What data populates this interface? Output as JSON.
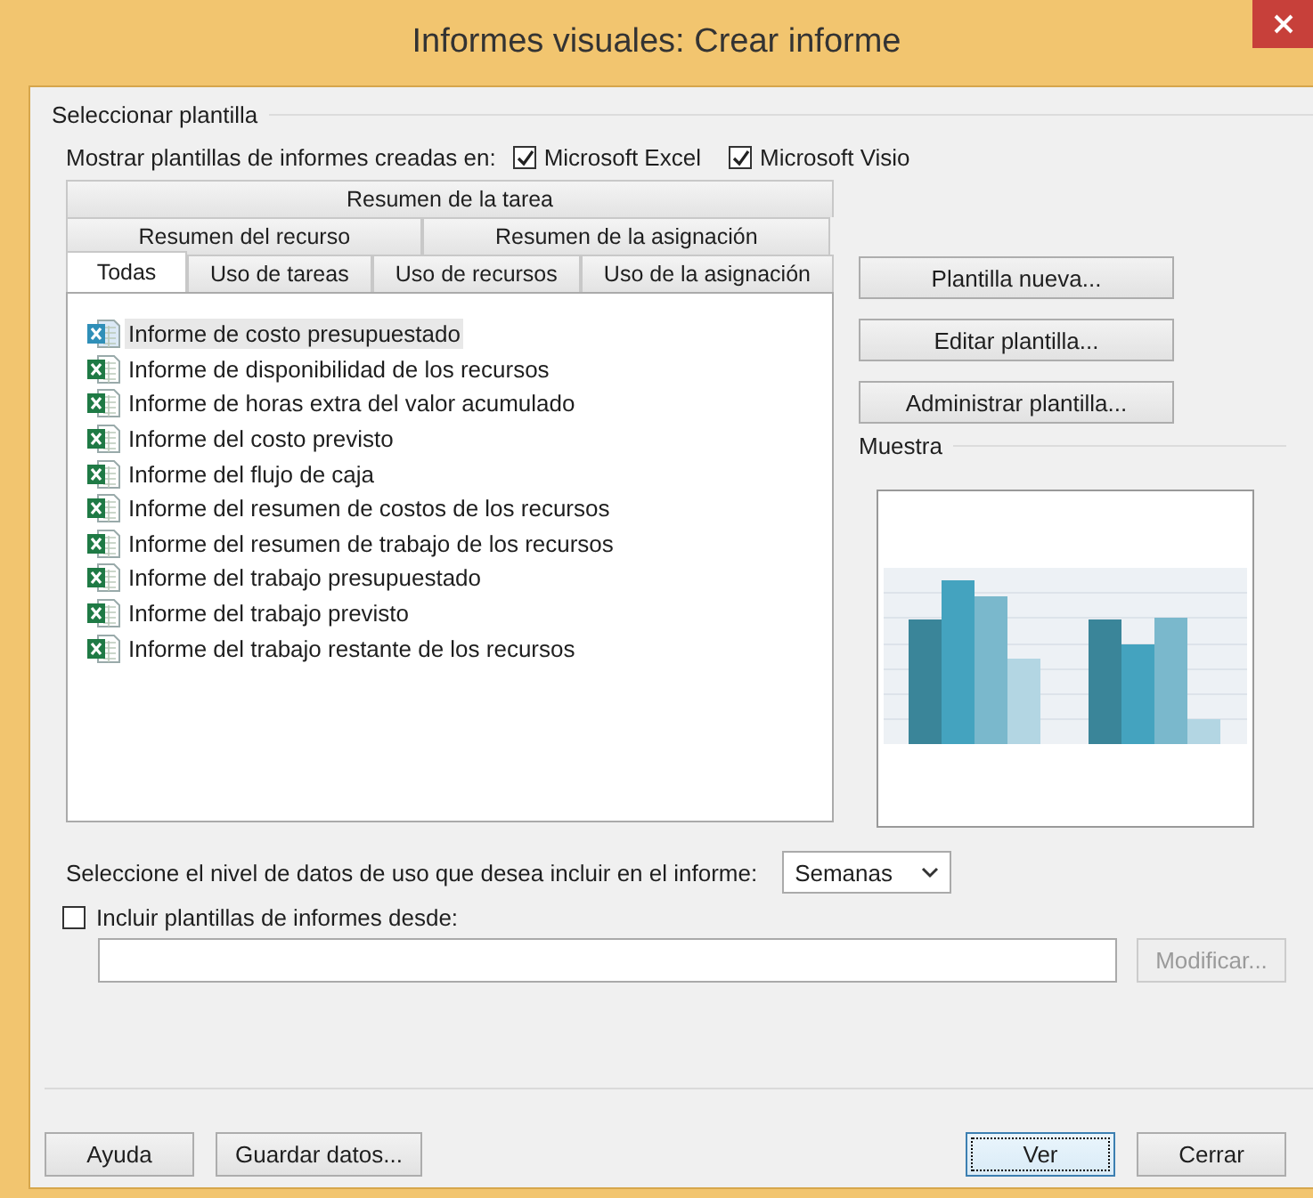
{
  "window": {
    "title": "Informes visuales: Crear informe"
  },
  "template_group": {
    "title": "Seleccionar plantilla",
    "show_label": "Mostrar plantillas de informes creadas en:",
    "sources": [
      {
        "label": "Microsoft Excel",
        "checked": true
      },
      {
        "label": "Microsoft Visio",
        "checked": true
      }
    ],
    "tab_rows": [
      [
        {
          "label": "Resumen de la tarea",
          "selected": false
        }
      ],
      [
        {
          "label": "Resumen del recurso",
          "selected": false
        },
        {
          "label": "Resumen de la asignación",
          "selected": false
        }
      ],
      [
        {
          "label": "Todas",
          "selected": true
        },
        {
          "label": "Uso de tareas",
          "selected": false
        },
        {
          "label": "Uso de recursos",
          "selected": false
        },
        {
          "label": "Uso de la asignación",
          "selected": false
        }
      ]
    ],
    "templates": [
      {
        "label": "Informe de costo presupuestado",
        "selected": true
      },
      {
        "label": "Informe de disponibilidad de los recursos",
        "selected": false
      },
      {
        "label": "Informe de horas extra del valor acumulado",
        "selected": false
      },
      {
        "label": "Informe del costo previsto",
        "selected": false
      },
      {
        "label": "Informe del flujo de caja",
        "selected": false
      },
      {
        "label": "Informe del resumen de costos de los recursos",
        "selected": false
      },
      {
        "label": "Informe del resumen de trabajo de los recursos",
        "selected": false
      },
      {
        "label": "Informe del trabajo presupuestado",
        "selected": false
      },
      {
        "label": "Informe del trabajo previsto",
        "selected": false
      },
      {
        "label": "Informe del trabajo restante de los recursos",
        "selected": false
      }
    ],
    "side_buttons": [
      "Plantilla nueva...",
      "Editar plantilla...",
      "Administrar plantilla..."
    ],
    "preview": {
      "title": "Muestra"
    }
  },
  "usage_level": {
    "label": "Seleccione el nivel de datos de uso que desea incluir en el informe:",
    "value": "Semanas"
  },
  "include": {
    "label": "Incluir plantillas de informes desde:",
    "checked": false,
    "button": {
      "label": "Modificar...",
      "disabled": true
    }
  },
  "footer_buttons": [
    {
      "label": "Ayuda",
      "default": false
    },
    {
      "label": "Guardar datos...",
      "default": false
    },
    {
      "label": "Ver",
      "default": true
    },
    {
      "label": "Cerrar",
      "default": false
    }
  ]
}
